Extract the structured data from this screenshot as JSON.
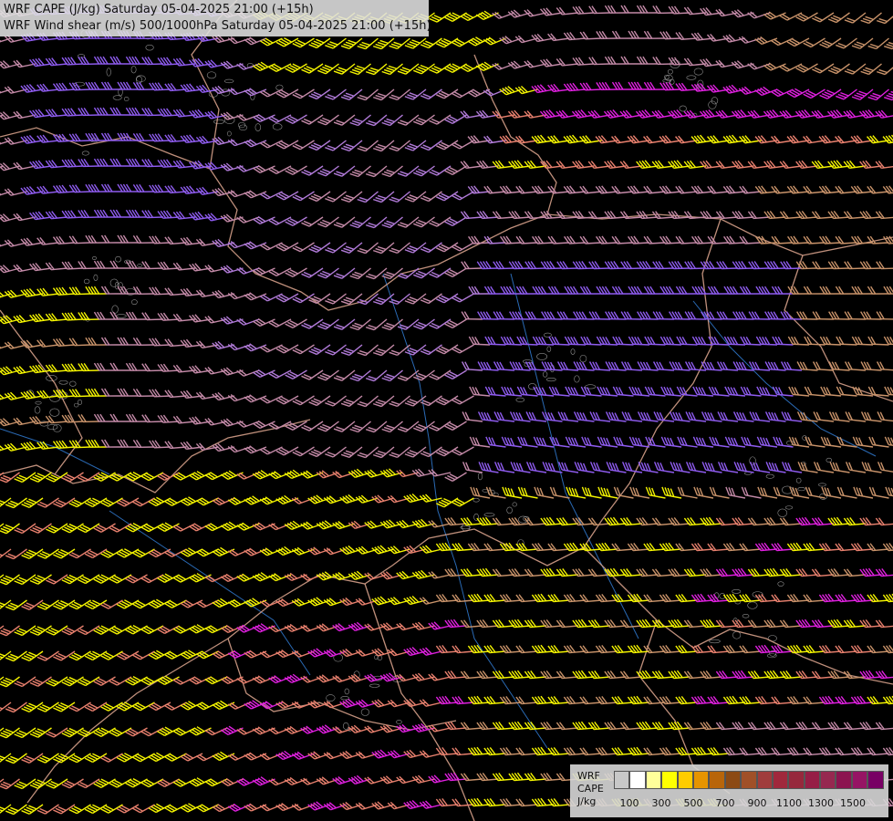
{
  "header": {
    "line1": "WRF CAPE (J/kg) Saturday 05-04-2025 21:00 (+15h)",
    "line2": "WRF Wind shear (m/s) 500/1000hPa Saturday 05-04-2025 21:00 (+15h)"
  },
  "legend": {
    "line1": "WRF",
    "line2": "CAPE",
    "line3": "J/kg",
    "colors": [
      "#c8c8c8",
      "#ffffff",
      "#ffff9a",
      "#ffff00",
      "#ffcc00",
      "#e69400",
      "#b8650a",
      "#8c4a14",
      "#a05028",
      "#a03c3c",
      "#a0283c",
      "#96283c",
      "#961e46",
      "#962850",
      "#8c1450",
      "#961464",
      "#780064"
    ],
    "ticks": [
      "100",
      "300",
      "500",
      "700",
      "900",
      "1100",
      "1300",
      "1500"
    ]
  },
  "map": {
    "background": "#000000",
    "barb_palette": {
      "violet": "#8f5cf0",
      "lilac": "#b07ad8",
      "mauve": "#c48aa8",
      "tan": "#c9936a",
      "salmon": "#e8806e",
      "yellow": "#f5f500",
      "magenta": "#e020e0"
    },
    "border_color": "#e0a890",
    "river_color": "#2a6ab5",
    "contour_color": "#b0b0b0"
  }
}
